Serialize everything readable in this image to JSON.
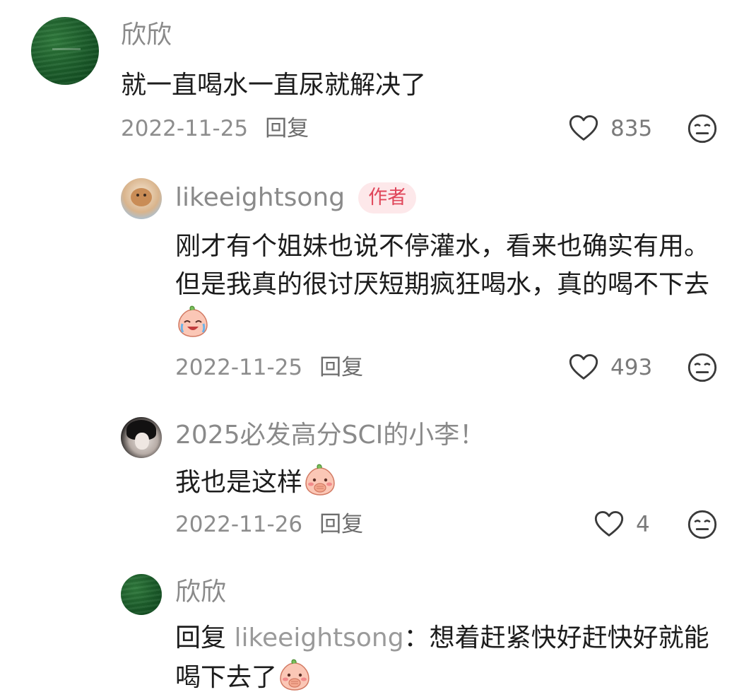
{
  "comments": [
    {
      "username": "欣欣",
      "text": "就一直喝水一直尿就解决了",
      "date": "2022-11-25",
      "reply_label": "回复",
      "likes": "835"
    },
    {
      "username": "likeeightsong",
      "badge": "作者",
      "text": "刚才有个姐妹也说不停灌水，看来也确实有用。但是我真的很讨厌短期疯狂喝水，真的喝不下去",
      "emoji": "crying-laughing-peach-emoji",
      "date": "2022-11-25",
      "reply_label": "回复",
      "likes": "493"
    },
    {
      "username": "2025必发高分SCI的小李！",
      "text": "我也是这样",
      "emoji": "shy-peach-emoji",
      "date": "2022-11-26",
      "reply_label": "回复",
      "likes": "4"
    },
    {
      "username": "欣欣",
      "reply_prefix": "回复",
      "mention": "likeeightsong",
      "mention_colon": "：",
      "text": "想着赶紧快好赶快好就能喝下去了",
      "emoji": "shy-peach-emoji"
    }
  ],
  "icons": {
    "like": "heart-outline-icon",
    "dislike": "neutral-face-icon"
  },
  "colors": {
    "badge_bg": "#fde8ea",
    "badge_text": "#e0465a",
    "meta_gray": "#8d8d8d"
  }
}
